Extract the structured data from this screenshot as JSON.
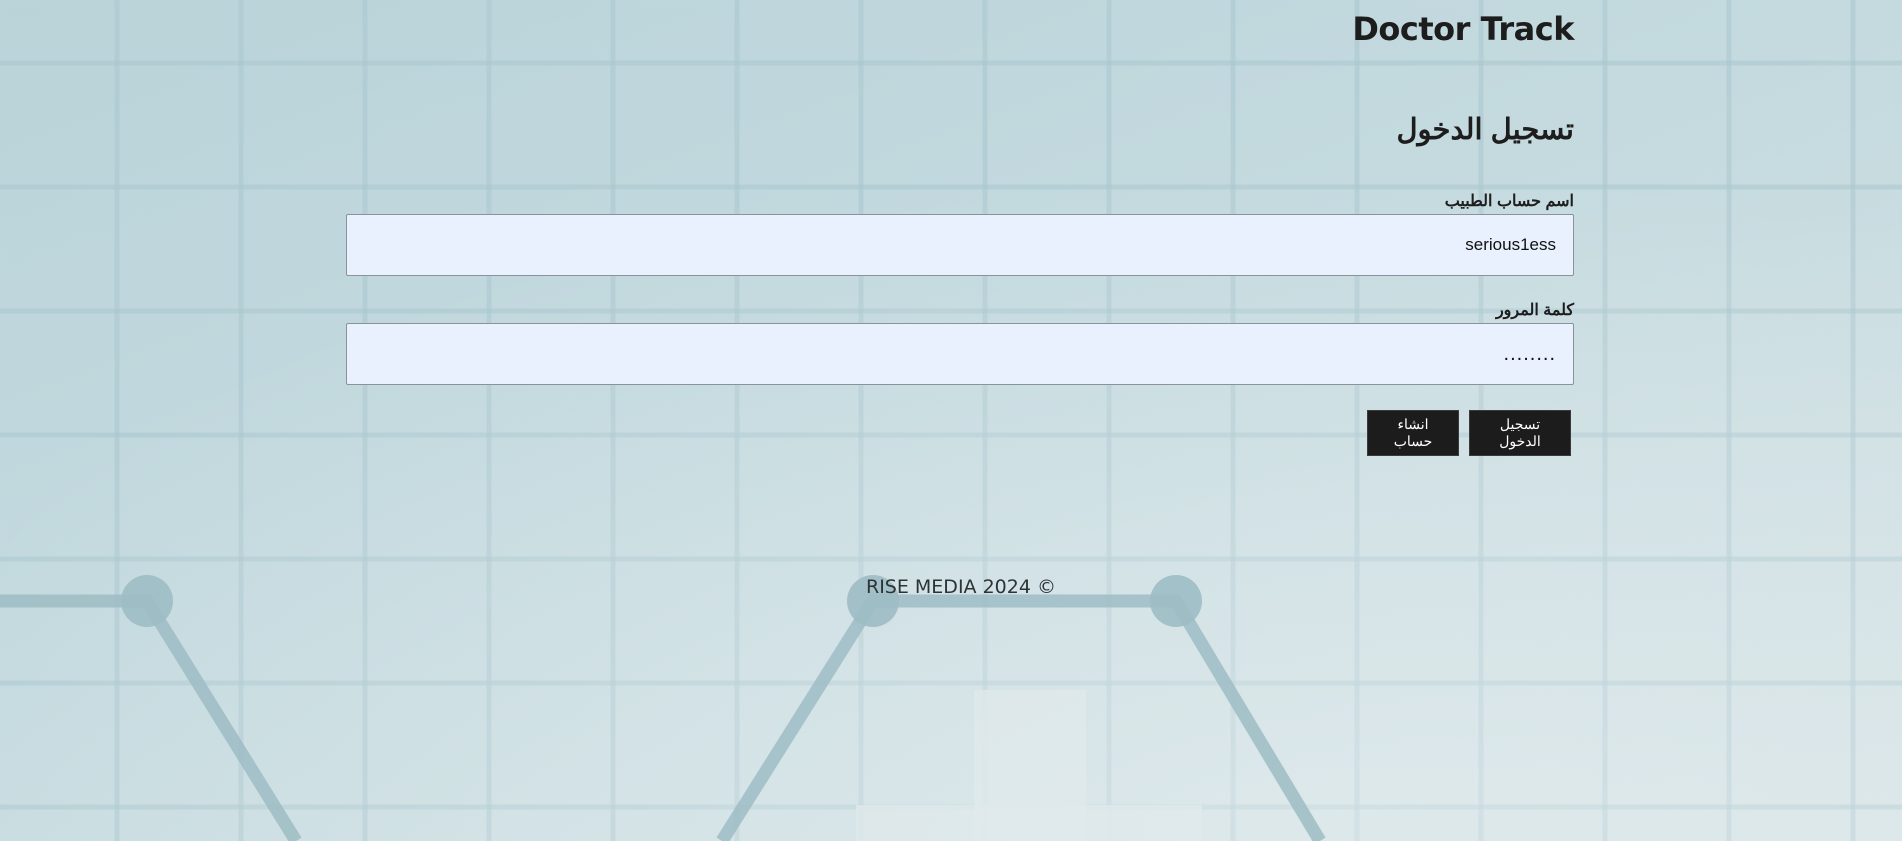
{
  "header": {
    "brand": "Doctor Track"
  },
  "login": {
    "title": "تسجيل الدخول",
    "username_label": "اسم حساب الطبيب",
    "username_value": "serious1ess",
    "password_label": "كلمة المرور",
    "password_value": "........",
    "login_button": "تسجيل الدخول",
    "signup_button": "انشاء حساب"
  },
  "footer": {
    "text": "RISE MEDIA 2024 ©"
  },
  "colors": {
    "background": "#bfd6db",
    "input_background": "#e8f1fd",
    "button_background": "#1c1c1c",
    "text": "#1d1d1d"
  }
}
